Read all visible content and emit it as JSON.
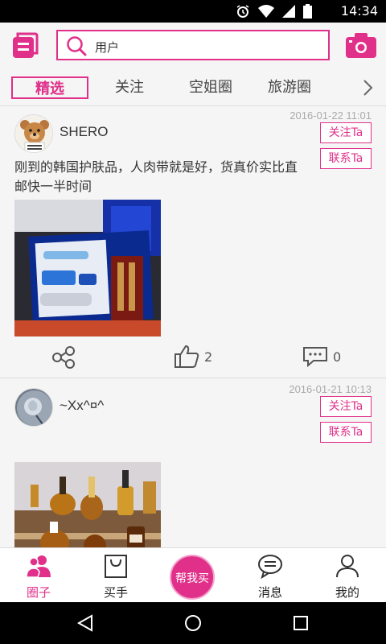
{
  "status_bar": {
    "time": "14:34"
  },
  "search": {
    "placeholder": "用户"
  },
  "tabs": [
    {
      "label": "精选",
      "active": true
    },
    {
      "label": "关注",
      "active": false
    },
    {
      "label": "空姐圈",
      "active": false
    },
    {
      "label": "旅游圈",
      "active": false
    }
  ],
  "posts": [
    {
      "username": "SHERO",
      "date": "2016-01-22 11:01",
      "follow_label": "关注Ta",
      "contact_label": "联系Ta",
      "text": "刚到的韩国护肤品，人肉带就是好，货真价实比直邮快一半时间",
      "likes": "2",
      "comments": "0"
    },
    {
      "username": "~Xx^¤^",
      "date": "2016-01-21 10:13",
      "follow_label": "关注Ta",
      "contact_label": "联系Ta"
    }
  ],
  "bottom_nav": [
    {
      "label": "圈子",
      "active": true
    },
    {
      "label": "买手",
      "active": false
    },
    {
      "label": "帮我买",
      "center": true
    },
    {
      "label": "消息",
      "active": false
    },
    {
      "label": "我的",
      "active": false
    }
  ],
  "colors": {
    "accent": "#e0308a",
    "background": "#f5f5f5"
  }
}
